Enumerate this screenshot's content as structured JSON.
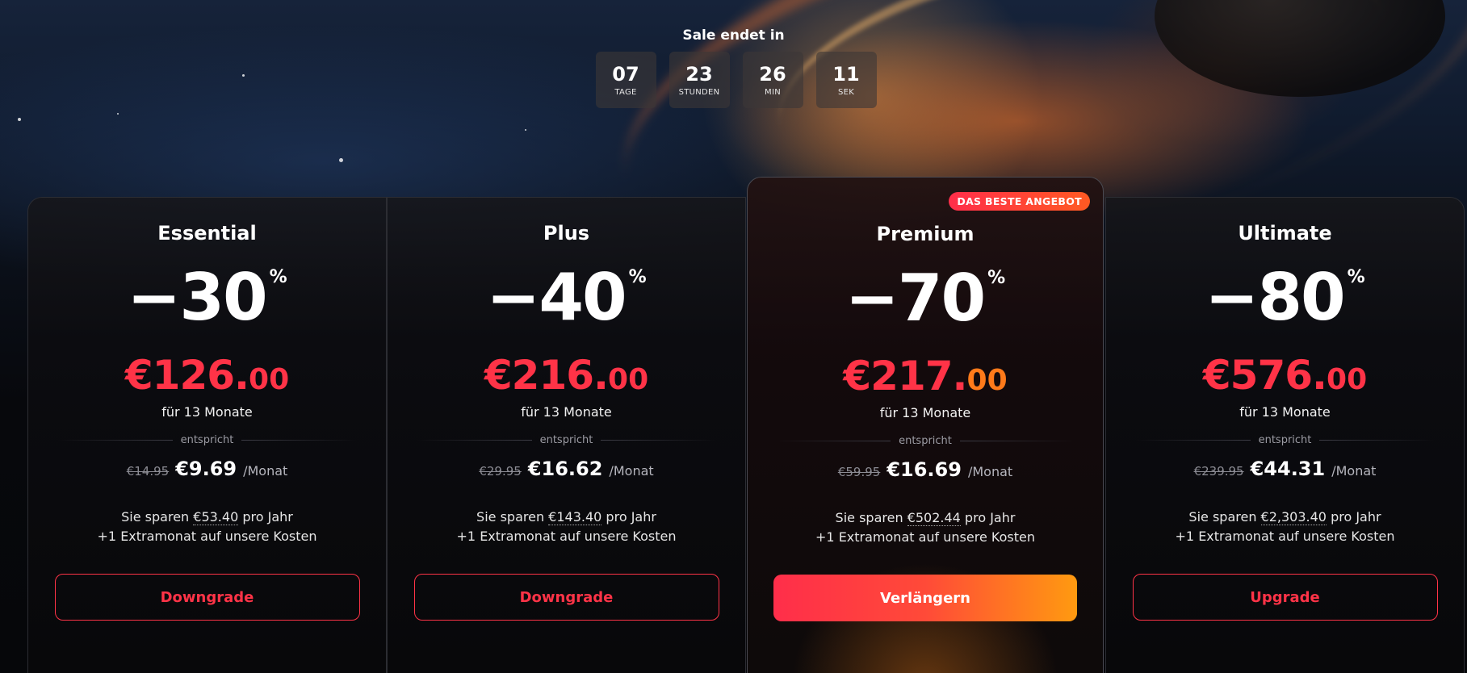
{
  "countdown": {
    "title": "Sale endet in",
    "units": [
      {
        "value": "07",
        "label": "TAGE"
      },
      {
        "value": "23",
        "label": "STUNDEN"
      },
      {
        "value": "26",
        "label": "MIN"
      },
      {
        "value": "11",
        "label": "SEK"
      }
    ]
  },
  "colors": {
    "accent_red": "#ff3347",
    "accent_orange": "#ff9a10"
  },
  "plans": [
    {
      "name": "Essential",
      "discount": "−30",
      "pct": "%",
      "price_main": "€126.",
      "price_cents": "00",
      "duration": "für 13 Monate",
      "divider": "entspricht",
      "old_price": "€14.95",
      "new_price": "€9.69",
      "per": "/Monat",
      "save_prefix": "Sie sparen ",
      "save_amount": "€53.40",
      "save_suffix": " pro Jahr",
      "extra": "+1 Extramonat auf unsere Kosten",
      "button": "Downgrade"
    },
    {
      "name": "Plus",
      "discount": "−40",
      "pct": "%",
      "price_main": "€216.",
      "price_cents": "00",
      "duration": "für 13 Monate",
      "divider": "entspricht",
      "old_price": "€29.95",
      "new_price": "€16.62",
      "per": "/Monat",
      "save_prefix": "Sie sparen ",
      "save_amount": "€143.40",
      "save_suffix": " pro Jahr",
      "extra": "+1 Extramonat auf unsere Kosten",
      "button": "Downgrade"
    },
    {
      "name": "Premium",
      "badge": "DAS BESTE ANGEBOT",
      "discount": "−70",
      "pct": "%",
      "price_main": "€217.",
      "price_cents": "00",
      "duration": "für 13 Monate",
      "divider": "entspricht",
      "old_price": "€59.95",
      "new_price": "€16.69",
      "per": "/Monat",
      "save_prefix": "Sie sparen ",
      "save_amount": "€502.44",
      "save_suffix": " pro Jahr",
      "extra": "+1 Extramonat auf unsere Kosten",
      "button": "Verlängern"
    },
    {
      "name": "Ultimate",
      "discount": "−80",
      "pct": "%",
      "price_main": "€576.",
      "price_cents": "00",
      "duration": "für 13 Monate",
      "divider": "entspricht",
      "old_price": "€239.95",
      "new_price": "€44.31",
      "per": "/Monat",
      "save_prefix": "Sie sparen ",
      "save_amount": "€2,303.40",
      "save_suffix": " pro Jahr",
      "extra": "+1 Extramonat auf unsere Kosten",
      "button": "Upgrade"
    }
  ]
}
